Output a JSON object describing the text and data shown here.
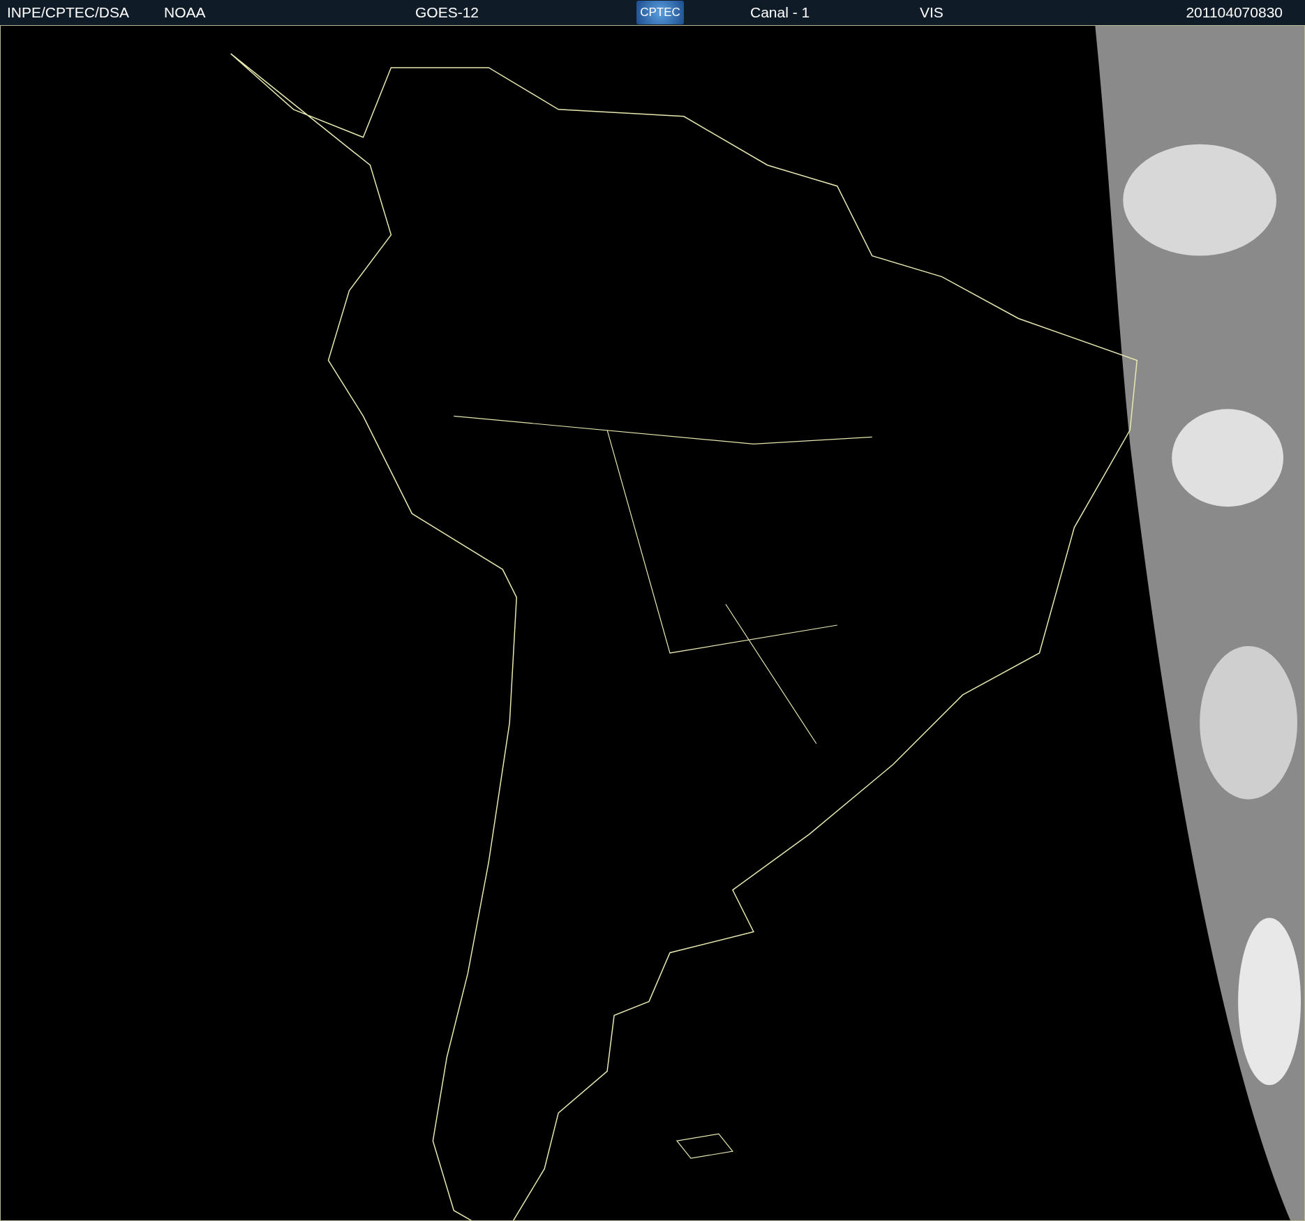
{
  "header": {
    "items": [
      {
        "kind": "text",
        "text": "INPE/CPTEC/DSA"
      },
      {
        "kind": "text",
        "text": "NOAA"
      },
      {
        "kind": "text",
        "text": "GOES-12"
      },
      {
        "kind": "logo",
        "text": "CPTEC"
      },
      {
        "kind": "text",
        "text": "Canal - 1"
      },
      {
        "kind": "text",
        "text": "VIS"
      },
      {
        "kind": "text",
        "text": "201104070830"
      }
    ]
  }
}
